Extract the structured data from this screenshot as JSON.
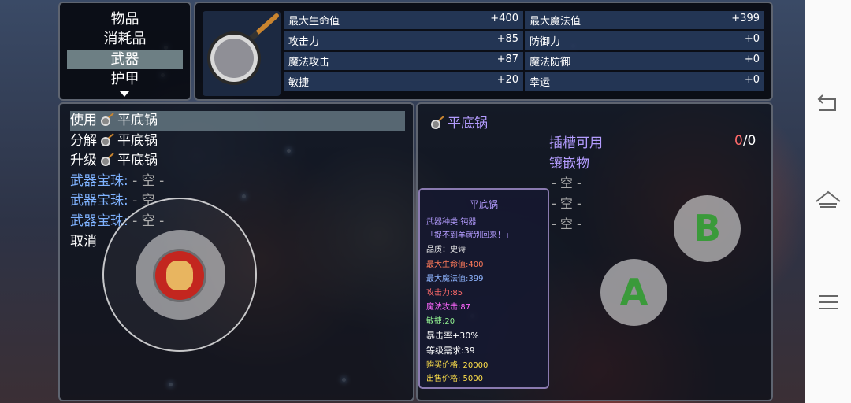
{
  "menu": {
    "items": [
      "物品",
      "消耗品",
      "武器",
      "护甲"
    ],
    "selected_index": 2
  },
  "stats": {
    "left": [
      {
        "label": "最大生命值",
        "value": "+400"
      },
      {
        "label": "攻击力",
        "value": "+85"
      },
      {
        "label": "魔法攻击",
        "value": "+87"
      },
      {
        "label": "敏捷",
        "value": "+20"
      }
    ],
    "right": [
      {
        "label": "最大魔法值",
        "value": "+399"
      },
      {
        "label": "防御力",
        "value": "+0"
      },
      {
        "label": "魔法防御",
        "value": "+0"
      },
      {
        "label": "幸运",
        "value": "+0"
      }
    ]
  },
  "commands": {
    "use_verb": "使用",
    "dismantle_verb": "分解",
    "upgrade_verb": "升级",
    "item_name": "平底锅",
    "gem_label": "武器宝珠:",
    "gem_empty": "- 空 -",
    "cancel": "取消"
  },
  "detail": {
    "item_name": "平底锅",
    "slots_available_label": "插槽可用",
    "slots_count_used": "0",
    "slots_count_total": "/0",
    "inlay_label": "镶嵌物",
    "empty_slot": "- 空 -"
  },
  "tooltip": {
    "title": "平底锅",
    "weapon_type": "武器种类:钝器",
    "quote": "「捉不到羊就别回来！」",
    "quality": "品质：史诗",
    "max_hp": "最大生命值:400",
    "max_mp": "最大魔法值:399",
    "attack": "攻击力:85",
    "magic_attack": "魔法攻击:87",
    "agility": "敏捷:20",
    "crit": "暴击率+30%",
    "level_req": "等级需求:39",
    "buy_price": "购买价格:  20000",
    "sell_price": "出售价格:  5000"
  },
  "controls": {
    "b_label": "B",
    "a_label": "A"
  },
  "colors": {
    "quality_epic": "#e8e8e8",
    "gem_label": "#7fb2ff",
    "detail_title": "#b49cff",
    "stat_row": "#28405f"
  }
}
